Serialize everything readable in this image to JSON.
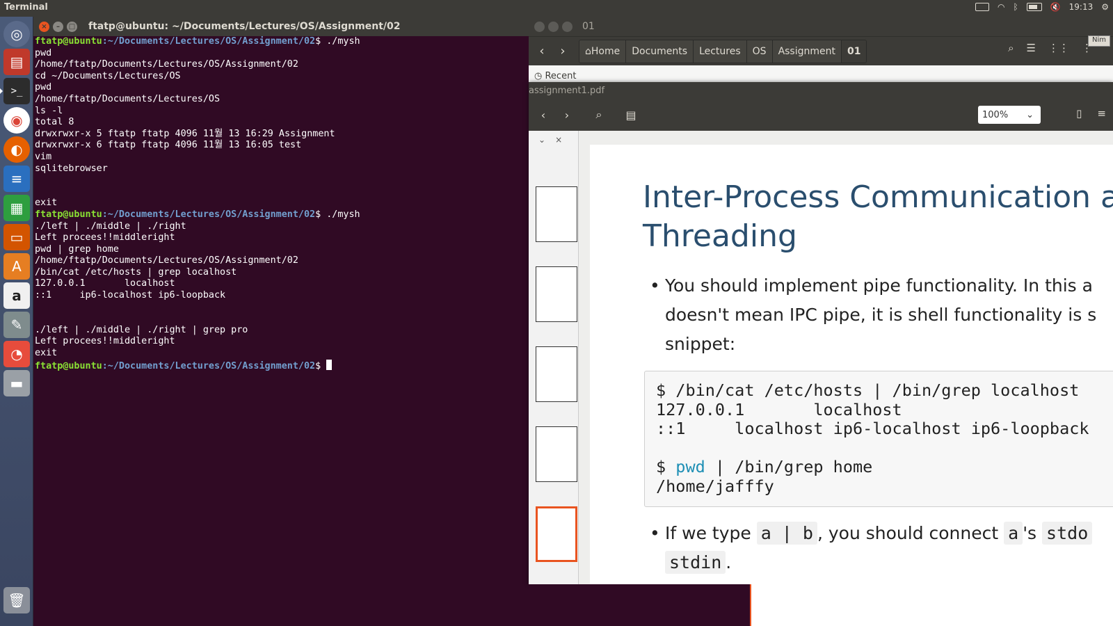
{
  "top_panel": {
    "app_title": "Terminal",
    "time": "19:13",
    "icons": [
      "keyboard-icon",
      "wifi-icon",
      "bluetooth-icon",
      "battery-icon",
      "volume-muted-icon",
      "gear-icon"
    ]
  },
  "launcher": {
    "items": [
      "dash-icon",
      "files-icon",
      "terminal-icon",
      "chrome-icon",
      "firefox-icon",
      "writer-icon",
      "calc-icon",
      "impress-icon",
      "software-center-icon",
      "amazon-icon",
      "settings-icon",
      "pdf-viewer-icon",
      "drive-icon",
      "trash-icon"
    ]
  },
  "terminal": {
    "title": "ftatp@ubuntu: ~/Documents/Lectures/OS/Assignment/02",
    "prompt_user": "ftatp@ubuntu",
    "prompt_path": ":~/Documents/Lectures/OS/Assignment/02",
    "prompt_suffix": "$",
    "lines": [
      {
        "type": "prompt",
        "cmd": " ./mysh"
      },
      {
        "type": "text",
        "text": "pwd"
      },
      {
        "type": "text",
        "text": "/home/ftatp/Documents/Lectures/OS/Assignment/02"
      },
      {
        "type": "text",
        "text": "cd ~/Documents/Lectures/OS"
      },
      {
        "type": "text",
        "text": "pwd"
      },
      {
        "type": "text",
        "text": "/home/ftatp/Documents/Lectures/OS"
      },
      {
        "type": "text",
        "text": "ls -l"
      },
      {
        "type": "text",
        "text": "total 8"
      },
      {
        "type": "text",
        "text": "drwxrwxr-x 5 ftatp ftatp 4096 11월 13 16:29 Assignment"
      },
      {
        "type": "text",
        "text": "drwxrwxr-x 6 ftatp ftatp 4096 11월 13 16:05 test"
      },
      {
        "type": "text",
        "text": "vim"
      },
      {
        "type": "text",
        "text": "sqlitebrowser"
      },
      {
        "type": "text",
        "text": ""
      },
      {
        "type": "text",
        "text": ""
      },
      {
        "type": "text",
        "text": "exit"
      },
      {
        "type": "prompt",
        "cmd": " ./mysh"
      },
      {
        "type": "text",
        "text": "./left | ./middle | ./right"
      },
      {
        "type": "text",
        "text": "Left procees!!middleright"
      },
      {
        "type": "text",
        "text": "pwd | grep home"
      },
      {
        "type": "text",
        "text": "/home/ftatp/Documents/Lectures/OS/Assignment/02"
      },
      {
        "type": "text",
        "text": "/bin/cat /etc/hosts | grep localhost"
      },
      {
        "type": "text",
        "text": "127.0.0.1       localhost"
      },
      {
        "type": "text",
        "text": "::1     ip6-localhost ip6-loopback"
      },
      {
        "type": "text",
        "text": ""
      },
      {
        "type": "text",
        "text": ""
      },
      {
        "type": "text",
        "text": "./left | ./middle | ./right | grep pro"
      },
      {
        "type": "text",
        "text": "Left procees!!middleright"
      },
      {
        "type": "text",
        "text": "exit"
      },
      {
        "type": "prompt_cursor",
        "cmd": " "
      }
    ]
  },
  "files": {
    "title": "01",
    "breadcrumbs": [
      "⌂Home",
      "Documents",
      "Lectures",
      "OS",
      "Assignment",
      "01"
    ],
    "sidebar_recent": "Recent",
    "corner_badge": "Nim"
  },
  "pdf": {
    "title": "assignment1.pdf",
    "zoom": "100%",
    "page": {
      "title_line1": "Inter-Process Communication ar",
      "title_line2": "Threading",
      "bullet1_line1": "You should implement pipe functionality. In this a",
      "bullet1_line2": "doesn't mean IPC pipe, it is shell functionality is s",
      "bullet1_line3": "snippet:",
      "code_lines": [
        "$ /bin/cat /etc/hosts | /bin/grep localhost",
        "127.0.0.1       localhost",
        "::1     localhost ip6-localhost ip6-loopback",
        "",
        "$ ",
        "/home/jafffy"
      ],
      "code_pwd": "pwd",
      "code_grep": " | /bin/grep home",
      "bullet2_prefix": "If we type ",
      "bullet2_code1": "a | b",
      "bullet2_mid": ", you should connect ",
      "bullet2_code2": "a",
      "bullet2_s": "'s ",
      "bullet2_code3": "stdo",
      "bullet2_code4": "stdin",
      "bullet2_end": "."
    }
  }
}
